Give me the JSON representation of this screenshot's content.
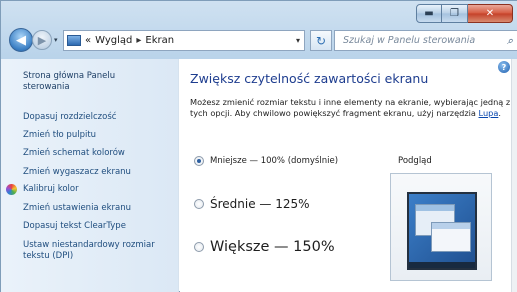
{
  "window": {
    "caption_buttons": {
      "minimize": "▬",
      "maximize": "❐",
      "close": "✕"
    }
  },
  "nav": {
    "back_symbol": "◀",
    "forward_symbol": "▶",
    "history_symbol": "▾",
    "address": {
      "prefix": "«",
      "crumb1": "Wygląd",
      "separator": "▸",
      "crumb2": "Ekran",
      "dropdown": "▾"
    },
    "refresh_symbol": "↻",
    "search_placeholder": "Szukaj w Panelu sterowania",
    "search_icon_symbol": "⌕"
  },
  "sidebar": {
    "home": "Strona główna Panelu sterowania",
    "items": [
      {
        "label": "Dopasuj rozdzielczość"
      },
      {
        "label": "Zmień tło pulpitu"
      },
      {
        "label": "Zmień schemat kolorów"
      },
      {
        "label": "Zmień wygaszacz ekranu"
      },
      {
        "label": "Kalibruj kolor"
      },
      {
        "label": "Zmień ustawienia ekranu"
      },
      {
        "label": "Dopasuj tekst ClearType"
      },
      {
        "label": "Ustaw niestandardowy rozmiar tekstu (DPI)"
      }
    ]
  },
  "main": {
    "help_symbol": "?",
    "title": "Zwiększ czytelność zawartości ekranu",
    "description": "Możesz zmienić rozmiar tekstu i inne elementy na ekranie, wybierając jedną z tych opcji. Aby chwilowo powiększyć fragment ekranu, użyj narzędzia",
    "description_link": "Lupa",
    "description_end": ".",
    "options": [
      {
        "label": "Mniejsze — 100% (domyślnie)",
        "selected": true
      },
      {
        "label": "Średnie — 125%",
        "selected": false
      },
      {
        "label": "Większe — 150%",
        "selected": false
      }
    ],
    "preview_label": "Podgląd"
  }
}
